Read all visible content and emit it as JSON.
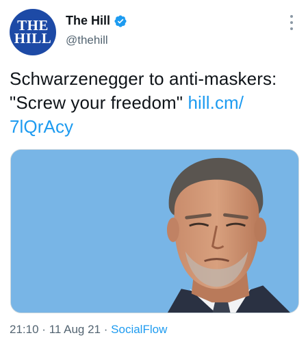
{
  "author": {
    "display_name": "The Hill",
    "handle": "@thehill",
    "avatar_line1": "THE",
    "avatar_line2": "HILL"
  },
  "tweet": {
    "text_main": "Schwarzenegger to anti-maskers: \"Screw your freedom\"",
    "link_text": "hill.cm/\n7lQrAcy",
    "link_part1": "hill.cm/",
    "link_part2": "7lQrAcy"
  },
  "meta": {
    "time": "21:10",
    "date": "11 Aug 21",
    "separator": "·",
    "source": "SocialFlow"
  },
  "colors": {
    "link": "#1d9bf0",
    "avatar_bg": "#1d4aa6",
    "sky": "#79b6e6"
  },
  "icons": [
    "verified-badge-icon",
    "more-options-icon"
  ]
}
